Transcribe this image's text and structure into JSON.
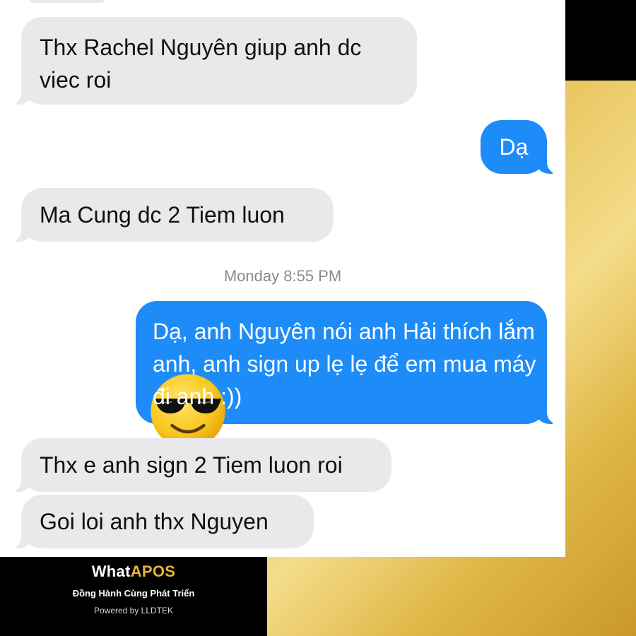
{
  "colors": {
    "incoming_bubble": "#e9e9eb",
    "outgoing_bubble": "#1d8cf8",
    "timestamp": "#8a8a8e",
    "gold": "#e6c35a",
    "brand_accent": "#e9b43a"
  },
  "messages": [
    {
      "direction": "incoming",
      "text": "Thx Rachel Nguyên giup anh dc viec roi"
    },
    {
      "direction": "outgoing",
      "text": "Dạ"
    },
    {
      "direction": "incoming",
      "text": "Ma Cung dc 2 Tiem luon"
    },
    {
      "direction": "outgoing",
      "text": "Dạ, anh Nguyên nói anh Hải thích lắm anh, anh sign up lẹ lẹ để em mua máy đi anh :))"
    },
    {
      "direction": "incoming",
      "text": "Thx e anh sign 2 Tiem luon roi"
    },
    {
      "direction": "incoming",
      "text": "Goi loi anh thx Nguyen"
    }
  ],
  "timestamp": "Monday 8:55 PM",
  "reaction": {
    "emoji_name": "smiling-face-with-sunglasses-icon"
  },
  "brand": {
    "logo_part1": "What",
    "logo_part2": "APOS",
    "tagline": "Đồng Hành Cùng Phát Triển",
    "powered_by": "Powered by LLDTEK"
  }
}
